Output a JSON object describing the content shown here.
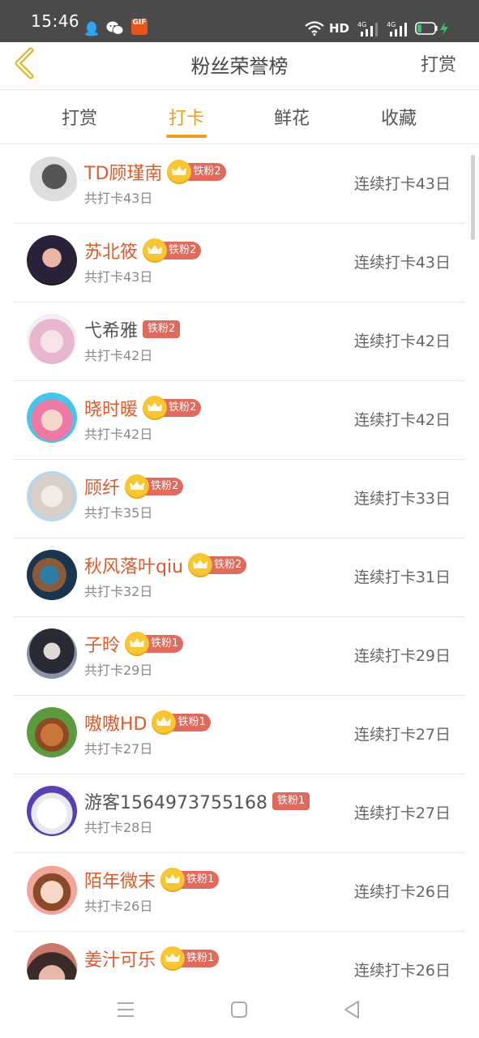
{
  "status_bar": {
    "time": "15:46",
    "network": "HD",
    "signal1": "4G",
    "signal2": "4G",
    "app_icon_text": "GIF"
  },
  "header": {
    "title": "粉丝荣誉榜",
    "action": "打赏"
  },
  "tabs": [
    {
      "label": "打赏",
      "active": false
    },
    {
      "label": "打卡",
      "active": true
    },
    {
      "label": "鲜花",
      "active": false
    },
    {
      "label": "收藏",
      "active": false
    }
  ],
  "rows": [
    {
      "name": "TD顾瑾南",
      "crown": true,
      "badge": "铁粉2",
      "total": "共打卡43日",
      "streak": "连续打卡43日"
    },
    {
      "name": "苏北筱",
      "crown": true,
      "badge": "铁粉2",
      "total": "共打卡43日",
      "streak": "连续打卡43日"
    },
    {
      "name": "弋希雅",
      "crown": false,
      "badge": "铁粉2",
      "total": "共打卡42日",
      "streak": "连续打卡42日"
    },
    {
      "name": "晓时暖",
      "crown": true,
      "badge": "铁粉2",
      "total": "共打卡42日",
      "streak": "连续打卡42日"
    },
    {
      "name": "顾纤",
      "crown": true,
      "badge": "铁粉2",
      "total": "共打卡35日",
      "streak": "连续打卡33日"
    },
    {
      "name": "秋风落叶qiu",
      "crown": true,
      "badge": "铁粉2",
      "total": "共打卡32日",
      "streak": "连续打卡31日"
    },
    {
      "name": "子昤",
      "crown": true,
      "badge": "铁粉1",
      "total": "共打卡29日",
      "streak": "连续打卡29日"
    },
    {
      "name": "嗷嗷HD",
      "crown": true,
      "badge": "铁粉1",
      "total": "共打卡27日",
      "streak": "连续打卡27日"
    },
    {
      "name": "游客1564973755168",
      "crown": false,
      "badge": "铁粉1",
      "total": "共打卡28日",
      "streak": "连续打卡27日"
    },
    {
      "name": "陌年微末",
      "crown": true,
      "badge": "铁粉1",
      "total": "共打卡26日",
      "streak": "连续打卡26日"
    },
    {
      "name": "姜汁可乐",
      "crown": true,
      "badge": "铁粉1",
      "total": "",
      "streak": "连续打卡26日"
    }
  ],
  "colors": {
    "accent": "#f29b1e",
    "name": "#e05a2b",
    "badge": "#e06a5c",
    "crown": "#f8c633"
  },
  "icons": {
    "back": "chevron-left-icon",
    "menu": "menu-icon",
    "home": "square-icon",
    "back_nav": "triangle-left-icon"
  }
}
